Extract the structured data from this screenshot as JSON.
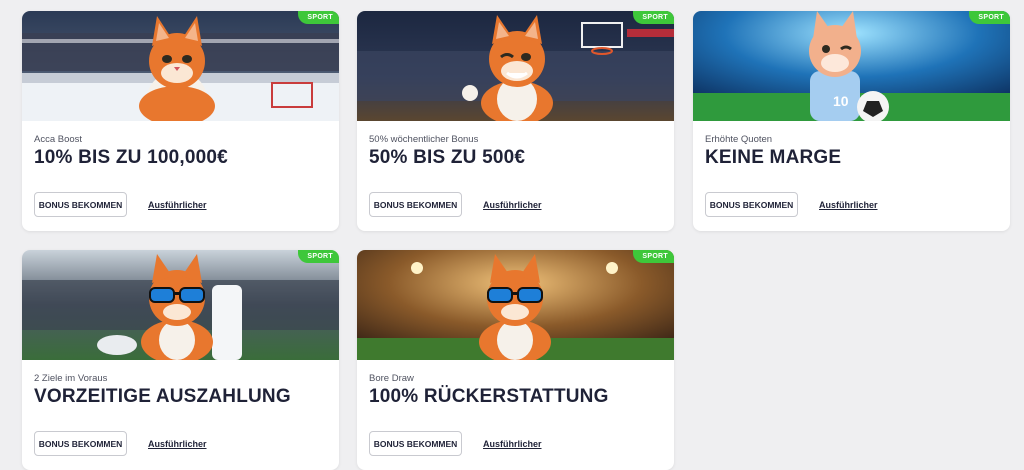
{
  "cards": [
    {
      "badge": "SPORT",
      "subtitle": "Acca Boost",
      "headline": "10% BIS ZU 100,000€",
      "button_label": "BONUS BEKOMMEN",
      "link_label": "Ausführlicher",
      "banner_theme": "ice-hockey-arena"
    },
    {
      "badge": "SPORT",
      "subtitle": "50% wöchentlicher Bonus",
      "headline": "50% BIS ZU 500€",
      "button_label": "BONUS BEKOMMEN",
      "link_label": "Ausführlicher",
      "banner_theme": "basketball-arena"
    },
    {
      "badge": "SPORT",
      "subtitle": "Erhöhte Quoten",
      "headline": "KEINE MARGE",
      "button_label": "BONUS BEKOMMEN",
      "link_label": "Ausführlicher",
      "banner_theme": "football-stadium"
    },
    {
      "badge": "SPORT",
      "subtitle": "2 Ziele im Voraus",
      "headline": "VORZEITIGE AUSZAHLUNG",
      "button_label": "BONUS BEKOMMEN",
      "link_label": "Ausführlicher",
      "banner_theme": "stadium-with-console"
    },
    {
      "badge": "SPORT",
      "subtitle": "Bore Draw",
      "headline": "100% RÜCKERSTATTUNG",
      "button_label": "BONUS BEKOMMEN",
      "link_label": "Ausführlicher",
      "banner_theme": "stadium-night-lights"
    }
  ],
  "colors": {
    "page_background": "#efeff1",
    "badge_green": "#3ec73a",
    "headline_navy": "#1f2237",
    "cat_orange": "#e8772e"
  }
}
